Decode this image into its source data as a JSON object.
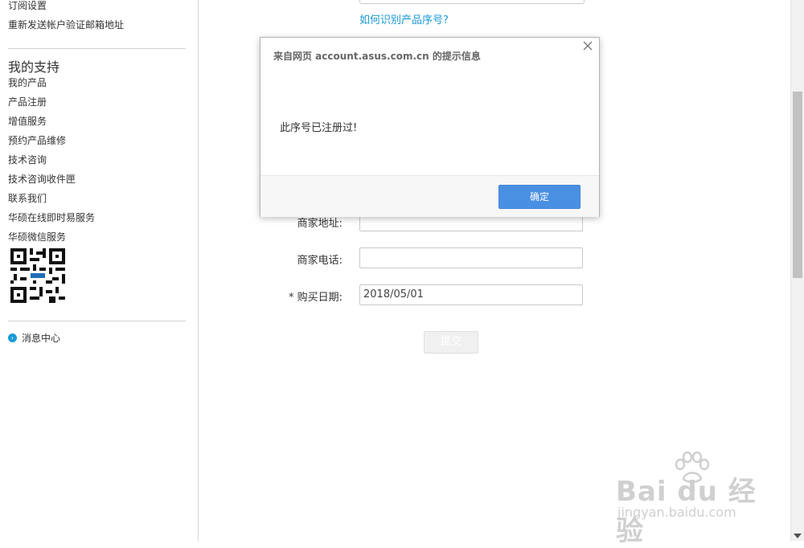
{
  "sidebar": {
    "top_items": [
      "订阅设置",
      "重新发送帐户验证邮箱地址"
    ],
    "support_heading": "我的支持",
    "support_items": [
      "我的产品",
      "产品注册",
      "增值服务",
      "预约产品维修",
      "技术咨询",
      "技术咨询收件匣",
      "联系我们",
      "华硕在线即时易服务",
      "华硕微信服务"
    ],
    "qr_icon": "qr-code-icon",
    "message_center": "消息中心"
  },
  "form": {
    "help_link": "如何识别产品序号?",
    "fields": [
      {
        "label": "商家地址:",
        "value": ""
      },
      {
        "label": "商家电话:",
        "value": ""
      },
      {
        "label": "* 购买日期:",
        "value": "2018/05/01"
      }
    ],
    "submit_label": "提交"
  },
  "dialog": {
    "title": "来自网页 account.asus.com.cn 的提示信息",
    "message": "此序号已注册过!",
    "ok_label": "确定",
    "close_icon": "close-icon"
  },
  "watermark": {
    "brand": "Bai du 经验",
    "url": "jingyan.baidu.com"
  },
  "colors": {
    "accent": "#1a9ad6",
    "primary_button": "#4a90e2"
  }
}
